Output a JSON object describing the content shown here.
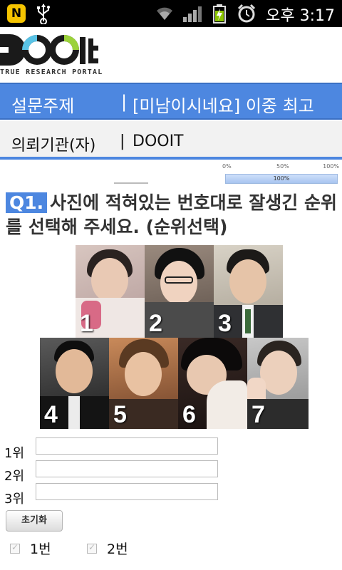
{
  "status_bar": {
    "app_badge": "N",
    "time": "오후 3:17",
    "icons": [
      "naver-app-icon",
      "usb-icon",
      "wifi-icon",
      "signal-icon",
      "battery-charging-icon",
      "alarm-icon"
    ]
  },
  "logo": {
    "name": "DOOIt",
    "tagline": "TRUE RESEARCH PORTAL"
  },
  "topic": {
    "label": "설문주제",
    "separator": "|",
    "value": "[미남이시네요] 이중 최고"
  },
  "requester": {
    "label": "의뢰기관(자)",
    "separator": "|",
    "value": "DOOIT"
  },
  "progress": {
    "tick_0": "0%",
    "tick_50": "50%",
    "tick_100": "100%",
    "value_label": "100%",
    "value": 1.0
  },
  "question": {
    "number": "Q1.",
    "text": "사진에 적혀있는 번호대로 잘생긴 순위를 선택해 주세요. (순위선택)"
  },
  "photos": [
    {
      "number": "1"
    },
    {
      "number": "2"
    },
    {
      "number": "3"
    },
    {
      "number": "4"
    },
    {
      "number": "5"
    },
    {
      "number": "6"
    },
    {
      "number": "7"
    }
  ],
  "ranks": [
    {
      "label": "1위",
      "value": ""
    },
    {
      "label": "2위",
      "value": ""
    },
    {
      "label": "3위",
      "value": ""
    }
  ],
  "reset_button": "초기화",
  "options": [
    {
      "label": "1번",
      "checked": false
    },
    {
      "label": "2번",
      "checked": false
    }
  ],
  "colors": {
    "accent": "#4d87e0",
    "status_bar": "#000000"
  }
}
